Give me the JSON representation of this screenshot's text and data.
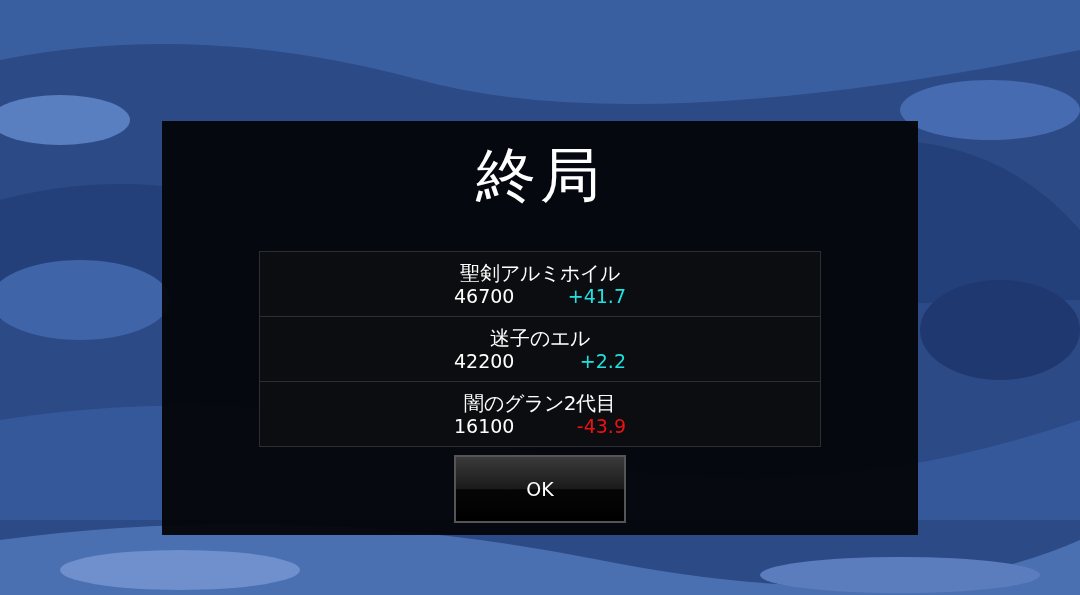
{
  "dialog": {
    "title": "終局",
    "results": [
      {
        "name": "聖剣アルミホイル",
        "score": "46700",
        "delta": "+41.7",
        "color": "#22e0e0"
      },
      {
        "name": "迷子のエル",
        "score": "42200",
        "delta": "+2.2",
        "color": "#22e0e0"
      },
      {
        "name": "闇のグラン2代目",
        "score": "16100",
        "delta": "-43.9",
        "color": "#ee1111"
      }
    ],
    "button": "OK"
  }
}
